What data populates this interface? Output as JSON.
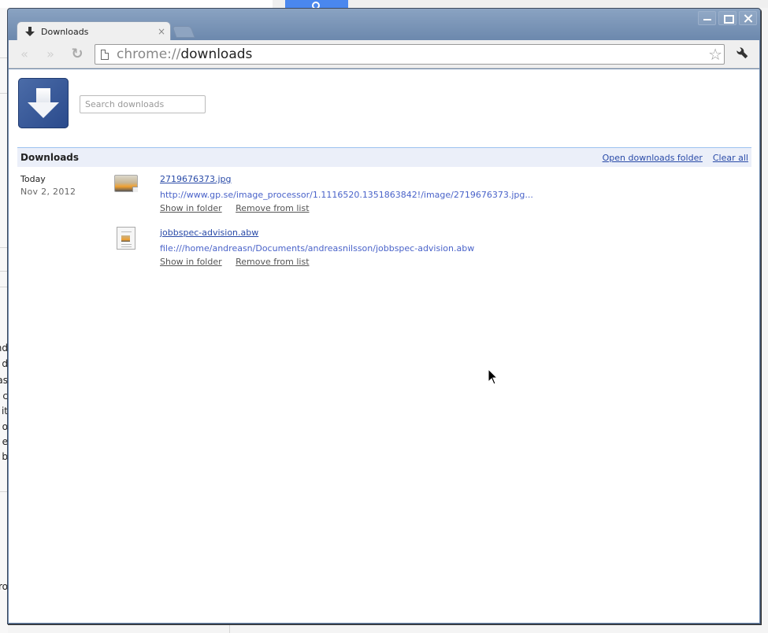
{
  "window": {
    "controls": {
      "minimize": "minimize",
      "maximize": "maximize",
      "close": "close"
    }
  },
  "tab": {
    "title": "Downloads",
    "icon": "download-arrow-icon",
    "close_glyph": "×"
  },
  "toolbar": {
    "back_glyph": "«",
    "forward_glyph": "»",
    "reload_glyph": "↻",
    "url_scheme": "chrome://",
    "url_host": "downloads",
    "star_glyph": "☆",
    "wrench_glyph": "🔧"
  },
  "page": {
    "search_placeholder": "Search downloads",
    "section_title": "Downloads",
    "open_folder_label": "Open downloads folder",
    "clear_all_label": "Clear all",
    "date_group": {
      "label": "Today",
      "date": "Nov 2, 2012"
    },
    "items": [
      {
        "name": "2719676373.jpg",
        "url": "http://www.gp.se/image_processor/1.1116520.1351863842!/image/2719676373.jpg...",
        "icon": "image-file-icon",
        "show_in_folder": "Show in folder",
        "remove": "Remove from list"
      },
      {
        "name": "jobbspec-advision.abw",
        "url": "file:///home/andreasn/Documents/andreasnilsson/jobbspec-advision.abw",
        "icon": "document-file-icon",
        "show_in_folder": "Show in folder",
        "remove": "Remove from list"
      }
    ]
  },
  "background": {
    "left_text_fragments": [
      "nd",
      "d",
      "as",
      "c",
      "it",
      "o",
      "e",
      "b",
      "ro"
    ]
  }
}
